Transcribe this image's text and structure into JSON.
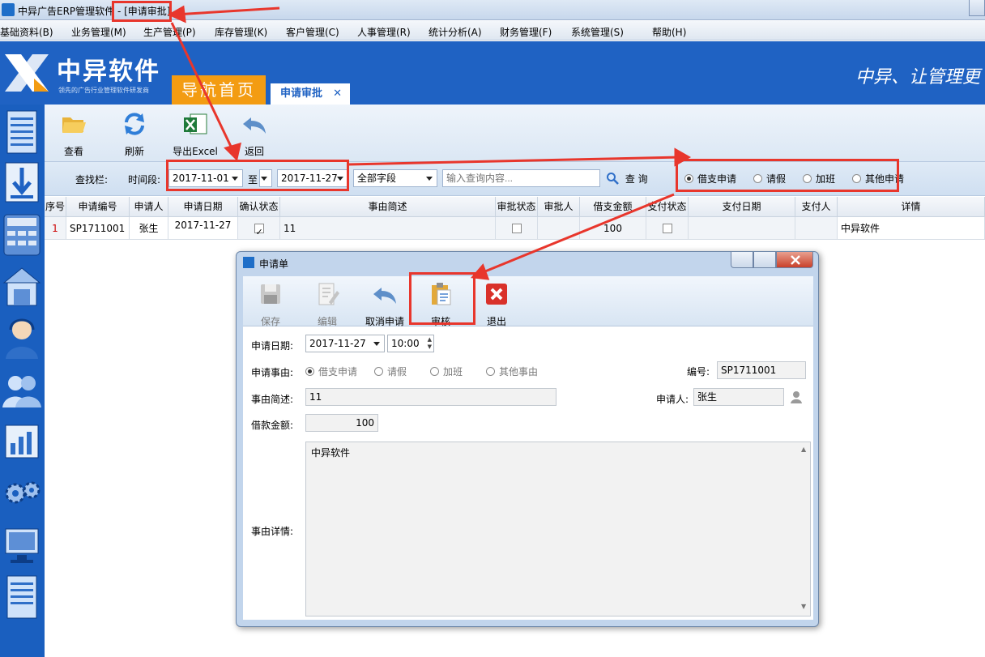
{
  "window": {
    "app_title": "中异广告ERP管理软件 - ",
    "active_doc": "[申请审批]"
  },
  "menu": [
    "基础资料(B)",
    "业务管理(M)",
    "生产管理(P)",
    "库存管理(K)",
    "客户管理(C)",
    "人事管理(R)",
    "统计分析(A)",
    "财务管理(F)",
    "系统管理(S)",
    "帮助(H)"
  ],
  "banner": {
    "brand": "中异软件",
    "tagline": "领先的广告行业管理软件研发商",
    "slogan": "中异、让管理更"
  },
  "nav": {
    "home": "导航首页",
    "active_tab": "申请审批",
    "close": "✕"
  },
  "toolbar": {
    "view": "查看",
    "refresh": "刷新",
    "export": "导出Excel",
    "back": "返回"
  },
  "search": {
    "label": "查找栏:",
    "period_label": "时间段:",
    "date_from": "2017-11-01",
    "to": "至",
    "date_to": "2017-11-27",
    "field": "全部字段",
    "query_placeholder": "输入查询内容...",
    "query_button": "查 询",
    "types": [
      "借支申请",
      "请假",
      "加班",
      "其他申请"
    ],
    "selected_type": "借支申请"
  },
  "grid": {
    "headers": [
      "序号",
      "申请编号",
      "申请人",
      "申请日期",
      "确认状态",
      "事由简述",
      "审批状态",
      "审批人",
      "借支金额",
      "支付状态",
      "支付日期",
      "支付人",
      "详情"
    ],
    "row": {
      "no": "1",
      "code": "SP1711001",
      "applicant": "张生",
      "date": "2017-11-27",
      "confirmed": true,
      "summary": "11",
      "approved": false,
      "approver": "",
      "amount": "100",
      "paid": false,
      "pay_date": "",
      "payer": "",
      "detail": "中异软件"
    }
  },
  "dialog": {
    "title": "申请单",
    "buttons": {
      "save": "保存",
      "edit": "编辑",
      "cancel": "取消申请",
      "audit": "审核",
      "exit": "退出"
    },
    "date_label": "申请日期:",
    "date": "2017-11-27",
    "time": "10:00",
    "reason_label": "申请事由:",
    "reasons": [
      "借支申请",
      "请假",
      "加班",
      "其他事由"
    ],
    "number_label": "编号:",
    "number": "SP1711001",
    "summary_label": "事由简述:",
    "summary": "11",
    "applicant_label": "申请人:",
    "applicant": "张生",
    "amount_label": "借款金额:",
    "amount": "100",
    "detail_label": "事由详情:",
    "detail": "中异软件"
  },
  "colors": {
    "brand_blue": "#1f62c3",
    "orange": "#f39c12",
    "annotation_red": "#e8362c"
  }
}
